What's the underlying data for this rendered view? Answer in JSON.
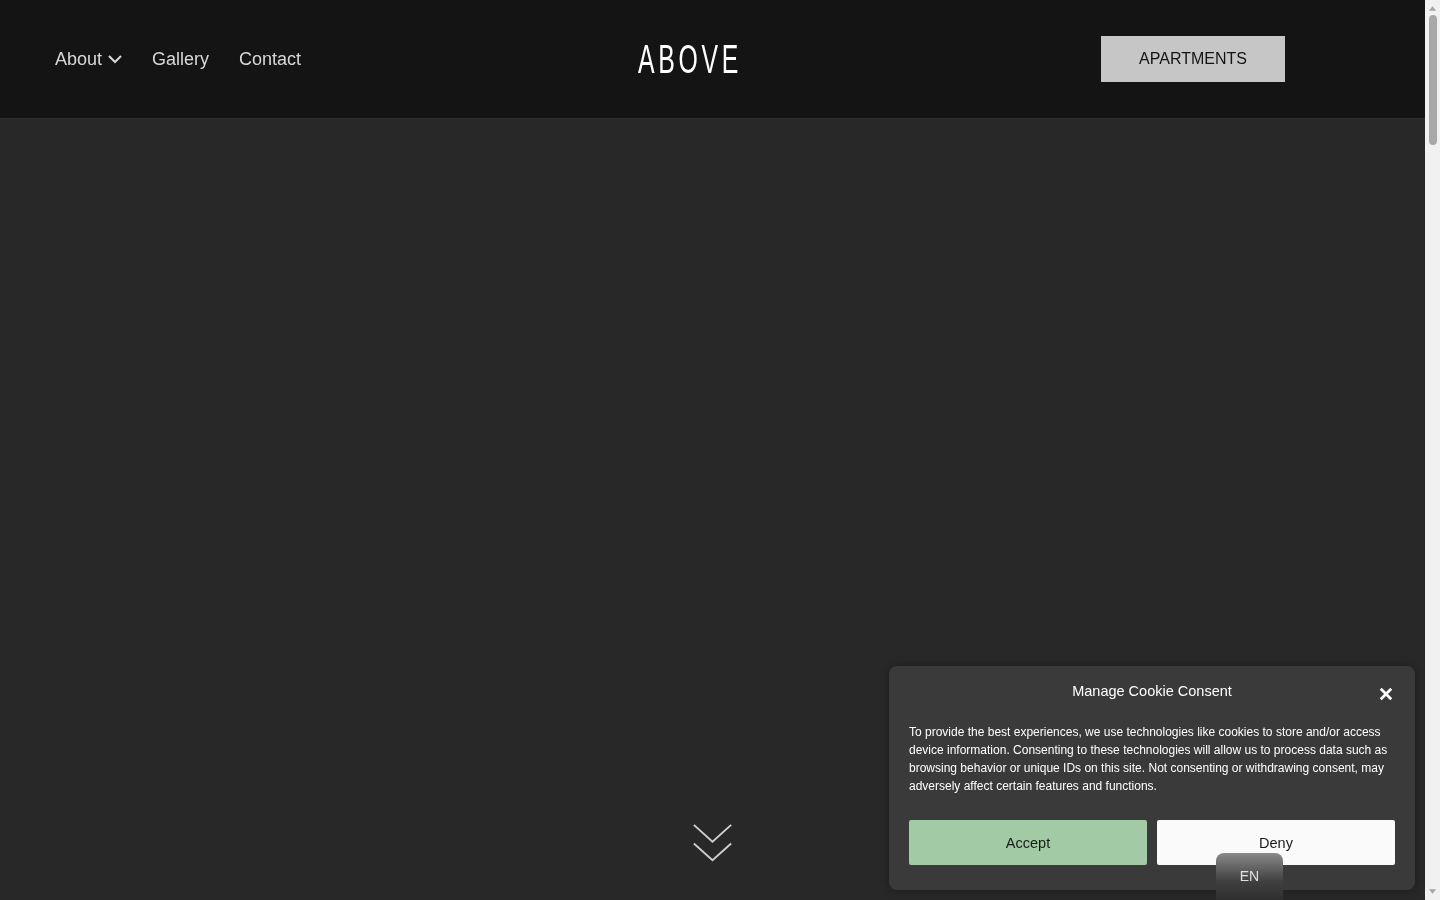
{
  "header": {
    "nav": [
      {
        "label": "About",
        "has_dropdown": true
      },
      {
        "label": "Gallery",
        "has_dropdown": false
      },
      {
        "label": "Contact",
        "has_dropdown": false
      }
    ],
    "logo": "ABOVE",
    "cta": "APARTMENTS"
  },
  "cookie_dialog": {
    "title": "Manage Cookie Consent",
    "text": "To provide the best experiences, we use technologies like cookies to store and/or access device information. Consenting to these technologies will allow us to process data such as browsing behavior or unique IDs on this site. Not consenting or withdrawing consent, may adversely affect certain features and functions.",
    "buttons": [
      {
        "label": "Accept",
        "kind": "primary"
      },
      {
        "label": "Deny",
        "kind": "secondary"
      }
    ]
  },
  "language": "EN"
}
